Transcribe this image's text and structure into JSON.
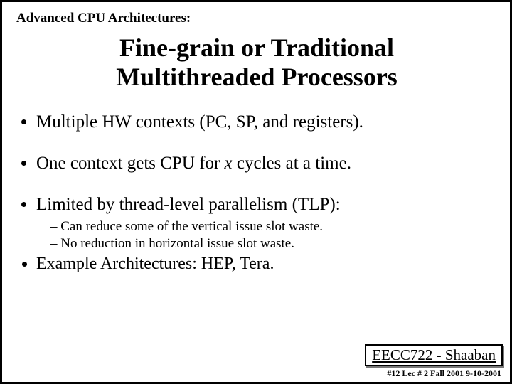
{
  "topic": "Advanced CPU Architectures:",
  "title_line1": "Fine-grain or Traditional",
  "title_line2": "Multithreaded Processors",
  "bullet1": "Multiple HW contexts (PC, SP, and registers).",
  "bullet2_a": "One context gets CPU for ",
  "bullet2_x": "x",
  "bullet2_b": " cycles at a time.",
  "bullet3": "Limited by thread-level parallelism (TLP):",
  "sub1": "Can reduce some of the vertical issue slot waste.",
  "sub2": "No reduction in horizontal issue slot waste.",
  "bullet4": "Example Architectures:  HEP, Tera.",
  "footer_course": "EECC722 - Shaaban",
  "footer_meta": "#12   Lec # 2    Fall 2001  9-10-2001"
}
